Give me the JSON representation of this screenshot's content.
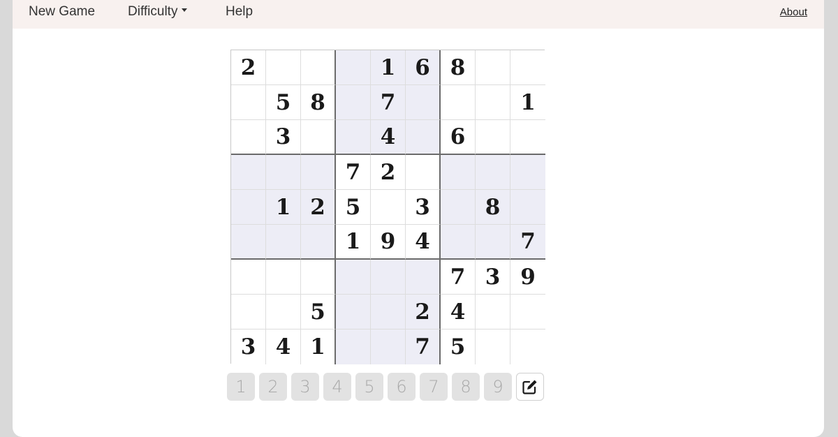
{
  "nav": {
    "new_game": "New Game",
    "difficulty": "Difficulty",
    "help": "Help",
    "about": "About"
  },
  "board": [
    [
      "2",
      "",
      "",
      "",
      "1",
      "6",
      "8",
      "",
      ""
    ],
    [
      "",
      "5",
      "8",
      "",
      "7",
      "",
      "",
      "",
      "1"
    ],
    [
      "",
      "3",
      "",
      "",
      "4",
      "",
      "6",
      "",
      ""
    ],
    [
      "",
      "",
      "",
      "7",
      "2",
      "",
      "",
      "",
      ""
    ],
    [
      "",
      "1",
      "2",
      "5",
      "",
      "3",
      "",
      "8",
      ""
    ],
    [
      "",
      "",
      "",
      "1",
      "9",
      "4",
      "",
      "",
      "7"
    ],
    [
      "",
      "",
      "",
      "",
      "",
      "",
      "7",
      "3",
      "9"
    ],
    [
      "",
      "",
      "5",
      "",
      "",
      "2",
      "4",
      "",
      ""
    ],
    [
      "3",
      "4",
      "1",
      "",
      "",
      "7",
      "5",
      "",
      ""
    ]
  ],
  "numpad": [
    "1",
    "2",
    "3",
    "4",
    "5",
    "6",
    "7",
    "8",
    "9"
  ],
  "icons": {
    "pencil": "pencil-square-icon",
    "dropdown": "caret-down-icon"
  },
  "colors": {
    "box_shade": "#ededf6",
    "navbar": "#f8f1ef"
  }
}
